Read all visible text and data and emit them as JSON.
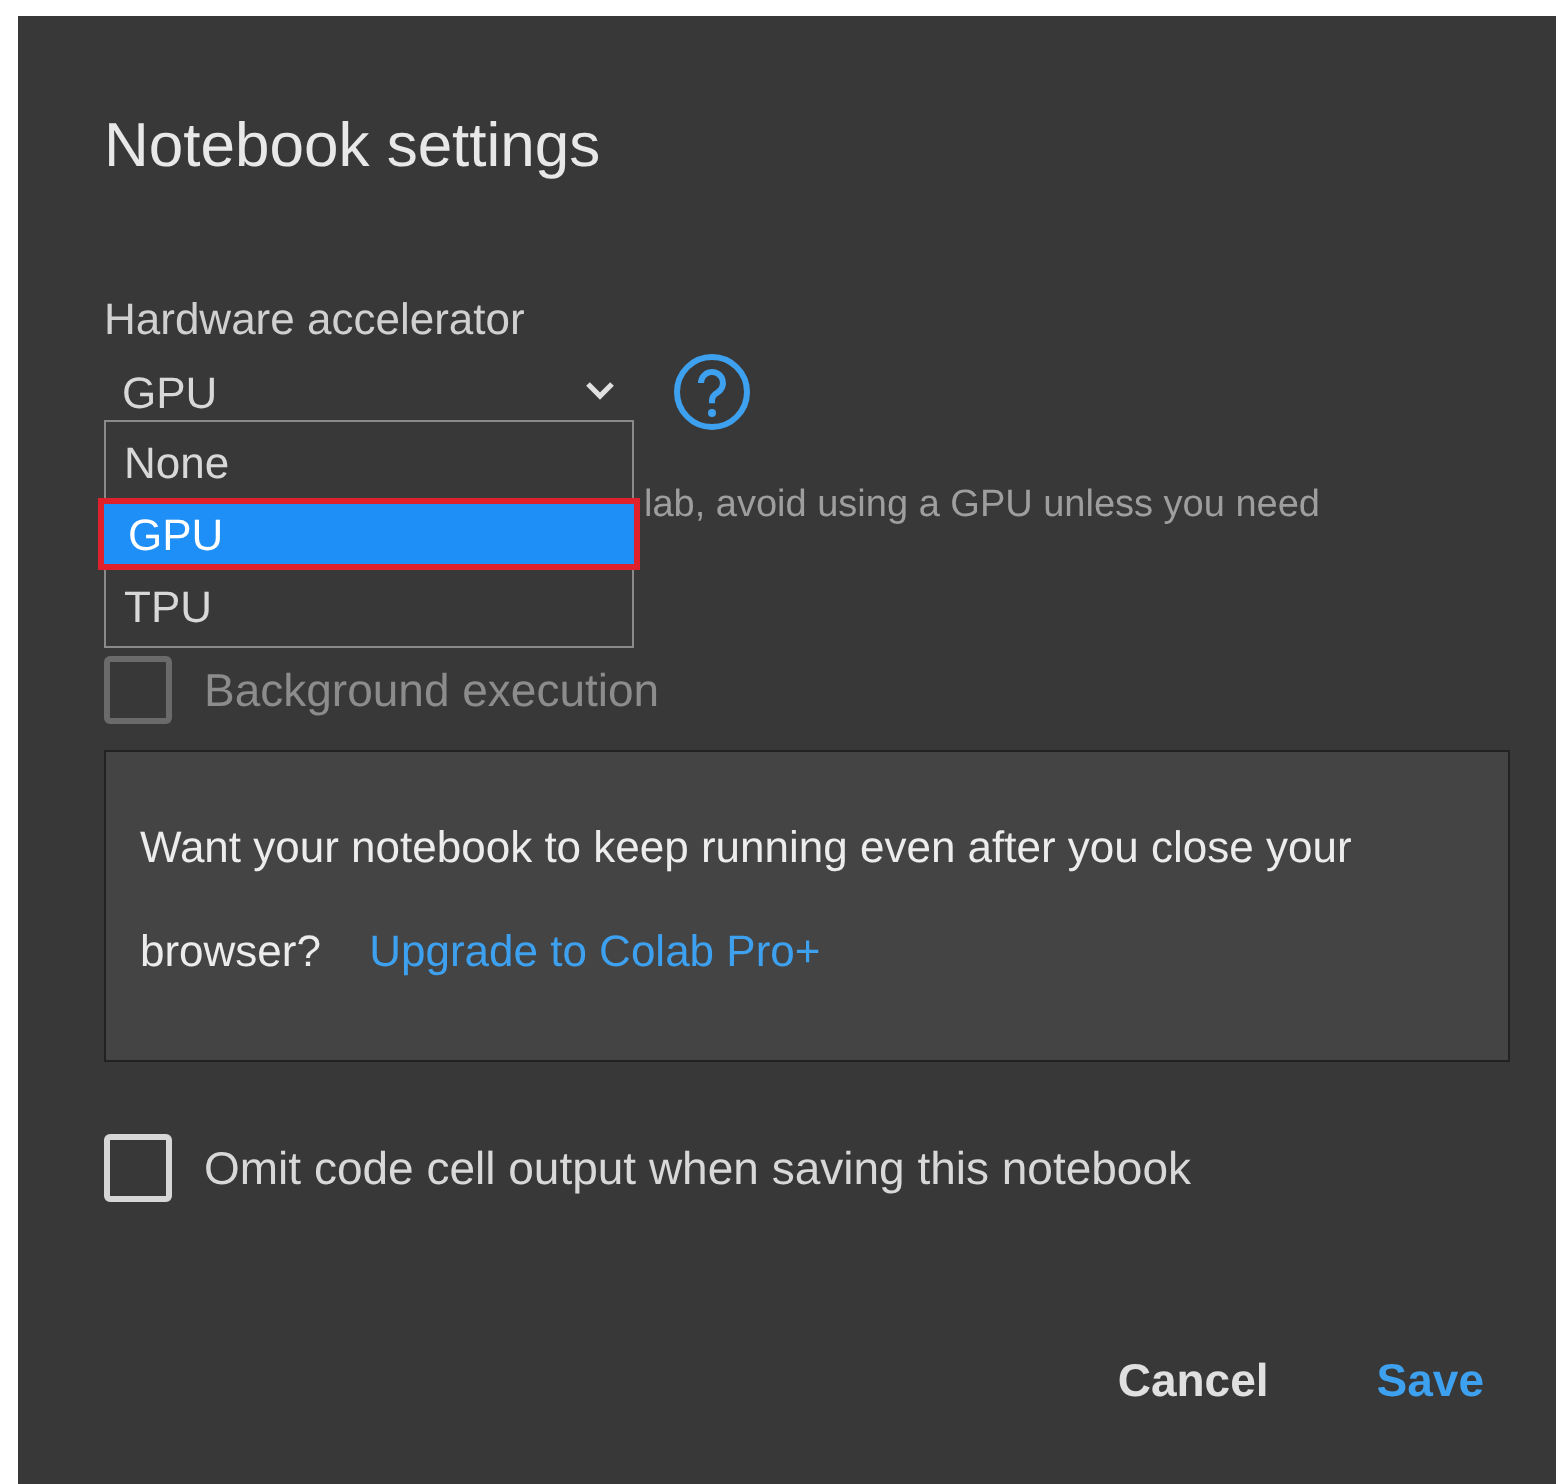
{
  "dialog": {
    "title": "Notebook settings"
  },
  "hardware_accelerator": {
    "label": "Hardware accelerator",
    "value": "GPU",
    "options": [
      {
        "label": "None",
        "selected": false
      },
      {
        "label": "GPU",
        "selected": true
      },
      {
        "label": "TPU",
        "selected": false
      }
    ],
    "note": "lab, avoid using a GPU unless you need"
  },
  "background_execution": {
    "label": "Background execution",
    "checked": false,
    "disabled": true
  },
  "upgrade_box": {
    "text": "Want your notebook to keep running even after you close your browser?",
    "link": "Upgrade to Colab Pro+"
  },
  "omit_output": {
    "label": "Omit code cell output when saving this notebook",
    "checked": false,
    "disabled": false
  },
  "buttons": [
    {
      "label": "Cancel",
      "kind": "secondary"
    },
    {
      "label": "Save",
      "kind": "primary"
    }
  ]
}
